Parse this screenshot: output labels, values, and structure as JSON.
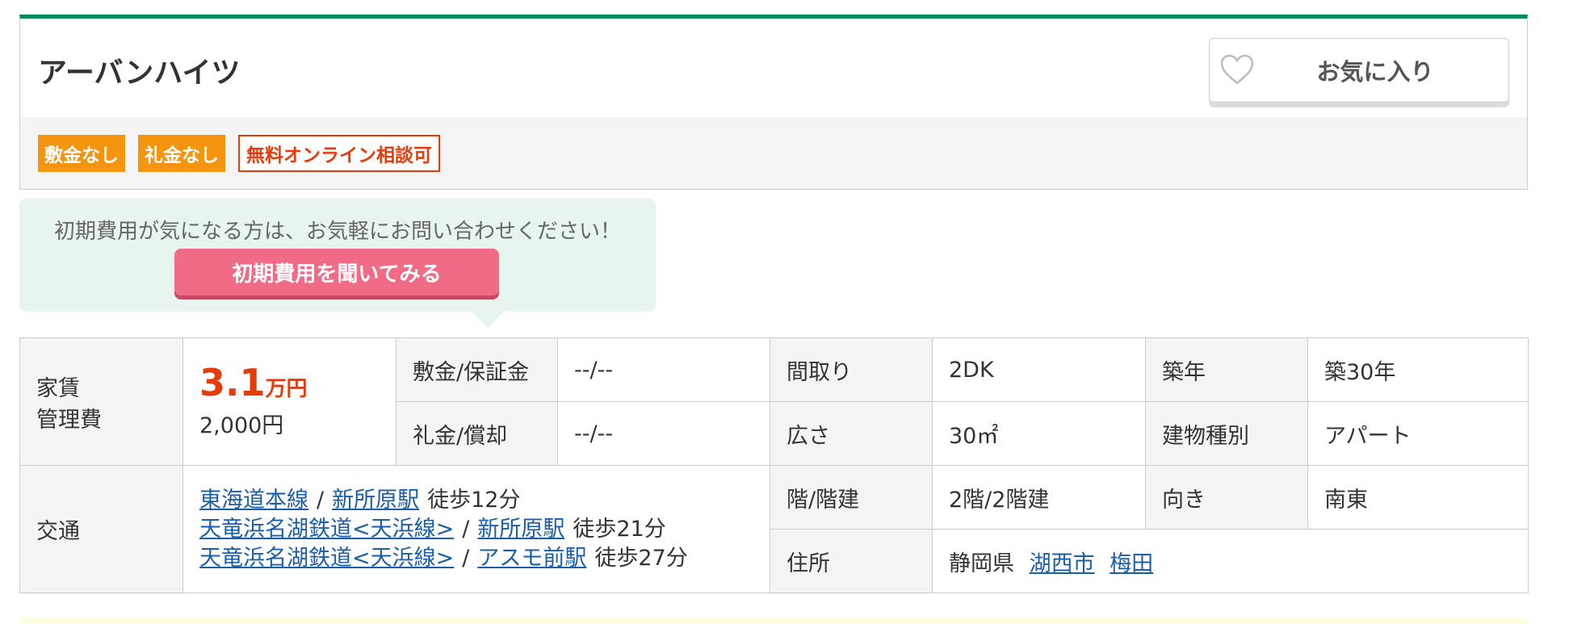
{
  "property": {
    "name": "アーバンハイツ"
  },
  "favorite": {
    "label": "お気に入り"
  },
  "tags": [
    {
      "label": "敷金なし",
      "style": "orange"
    },
    {
      "label": "礼金なし",
      "style": "orange"
    },
    {
      "label": "無料オンライン相談可",
      "style": "outline"
    }
  ],
  "inquiry": {
    "message": "初期費用が気になる方は、お気軽にお問い合わせください！",
    "button_label": "初期費用を聞いてみる"
  },
  "spec": {
    "rent_header_1": "家賃",
    "rent_header_2": "管理費",
    "rent_value": "3.1",
    "rent_unit": "万円",
    "management_fee": "2,000円",
    "deposit_header": "敷金/保証金",
    "deposit_value": "--/--",
    "keymoney_header": "礼金/償却",
    "keymoney_value": "--/--",
    "layout_header": "間取り",
    "layout_value": "2DK",
    "age_header": "築年",
    "age_value": "築30年",
    "area_header": "広さ",
    "area_value": "30㎡",
    "building_type_header": "建物種別",
    "building_type_value": "アパート",
    "access_header": "交通",
    "floor_header": "階/階建",
    "floor_value": "2階/2階建",
    "direction_header": "向き",
    "direction_value": "南東",
    "address_header": "住所",
    "address_prefecture": "静岡県",
    "address_city": "湖西市",
    "address_area": "梅田"
  },
  "access": [
    {
      "line": "東海道本線",
      "station": "新所原駅",
      "walk": "徒歩12分"
    },
    {
      "line": "天竜浜名湖鉄道<天浜線>",
      "station": "新所原駅",
      "walk": "徒歩21分"
    },
    {
      "line": "天竜浜名湖鉄道<天浜線>",
      "station": "アスモ前駅",
      "walk": "徒歩27分"
    }
  ],
  "separator": "/",
  "colors": {
    "brand_green": "#008a5a",
    "tag_orange": "#f5950f",
    "accent_red": "#e53c0c",
    "button_pink": "#f26b86",
    "link_blue": "#1a5ea8"
  },
  "icons": {
    "favorite": "heart-outline-icon"
  }
}
